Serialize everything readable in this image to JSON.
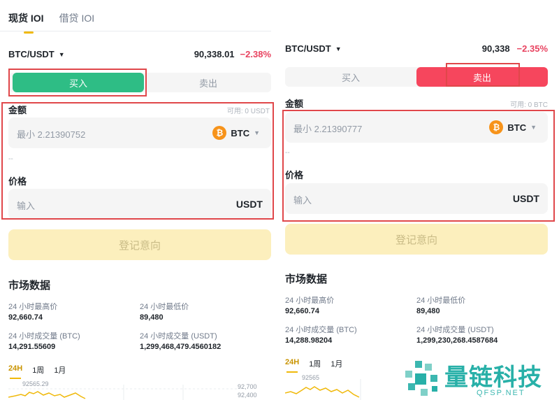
{
  "tabs": [
    "现货 IOI",
    "借贷 IOI"
  ],
  "left": {
    "pair": "BTC/USDT",
    "price": "90,338.01",
    "change": "−2.38%",
    "buy_label": "买入",
    "sell_label": "卖出",
    "amount_label": "金额",
    "available": "可用: 0 USDT",
    "amount_placeholder": "最小 2.21390752",
    "coin": "BTC",
    "dash": "--",
    "price_label": "价格",
    "price_placeholder": "输入",
    "price_unit": "USDT",
    "register": "登记意向",
    "market_title": "市场数据",
    "stats": [
      {
        "label": "24 小时最高价",
        "value": "92,660.74"
      },
      {
        "label": "24 小时最低价",
        "value": "89,480"
      },
      {
        "label": "24 小时成交量 (BTC)",
        "value": "14,291.55609"
      },
      {
        "label": "24 小时成交量 (USDT)",
        "value": "1,299,468,479.4560182"
      }
    ],
    "ranges": [
      "24H",
      "1周",
      "1月"
    ],
    "chart_top_label": "92565.29",
    "axis": [
      "92,700",
      "92,400"
    ]
  },
  "right": {
    "pair": "BTC/USDT",
    "price": "90,338",
    "change": "−2.35%",
    "buy_label": "买入",
    "sell_label": "卖出",
    "amount_label": "金额",
    "available": "可用: 0 BTC",
    "amount_placeholder": "最小 2.21390777",
    "coin": "BTC",
    "dash": "--",
    "price_label": "价格",
    "price_placeholder": "输入",
    "price_unit": "USDT",
    "register": "登记意向",
    "market_title": "市场数据",
    "stats": [
      {
        "label": "24 小时最高价",
        "value": "92,660.74"
      },
      {
        "label": "24 小时最低价",
        "value": "89,480"
      },
      {
        "label": "24 小时成交量 (BTC)",
        "value": "14,288.98204"
      },
      {
        "label": "24 小时成交量 (USDT)",
        "value": "1,299,230,268.4587684"
      }
    ],
    "ranges": [
      "24H",
      "1周",
      "1月"
    ],
    "chart_top_label": "92565"
  },
  "watermark": {
    "title": "量链科技",
    "sub": "QFSP.NET"
  },
  "colors": {
    "buy": "#2ebd85",
    "sell": "#f6465d",
    "accent": "#f0b90b",
    "negative": "#e84360",
    "highlight_box": "#e0474a"
  }
}
